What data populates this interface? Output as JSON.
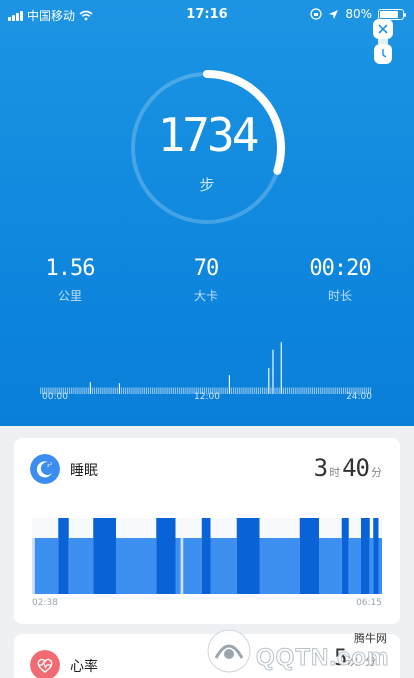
{
  "status_bar": {
    "carrier": "中国移动",
    "time": "17:16",
    "battery": "80%"
  },
  "summary": {
    "steps": "1734",
    "steps_unit": "步",
    "goal_fraction": 0.3
  },
  "stats": [
    {
      "value": "1.56",
      "label": "公里"
    },
    {
      "value": "70",
      "label": "大卡"
    },
    {
      "value": "00:20",
      "label": "时长"
    }
  ],
  "activity_chart": {
    "x_labels": [
      "00:00",
      "12:00",
      "24:00"
    ],
    "bars": [
      0.12,
      0.12,
      0.12,
      0.12,
      0.12,
      0.12,
      0.12,
      0.12,
      0.12,
      0.12,
      0.12,
      0.12,
      0.12,
      0.12,
      0.12,
      0.12,
      0.12,
      0.12,
      0.12,
      0.12,
      0.12,
      0.12,
      0.12,
      0.12,
      0.22,
      0.12,
      0.12,
      0.12,
      0.12,
      0.12,
      0.12,
      0.12,
      0.12,
      0.12,
      0.12,
      0.12,
      0.12,
      0.12,
      0.2,
      0.12,
      0.12,
      0.12,
      0.12,
      0.12,
      0.12,
      0.12,
      0.12,
      0.12,
      0.12,
      0.12,
      0.12,
      0.12,
      0.12,
      0.12,
      0.12,
      0.12,
      0.12,
      0.12,
      0.12,
      0.12,
      0.12,
      0.12,
      0.12,
      0.12,
      0.12,
      0.12,
      0.12,
      0.12,
      0.12,
      0.12,
      0.12,
      0.12,
      0.12,
      0.12,
      0.12,
      0.12,
      0.12,
      0.12,
      0.12,
      0.12,
      0.12,
      0.12,
      0.12,
      0.12,
      0.12,
      0.12,
      0.12,
      0.12,
      0.12,
      0.12,
      0.12,
      0.35,
      0.12,
      0.12,
      0.12,
      0.12,
      0.12,
      0.12,
      0.12,
      0.12,
      0.12,
      0.12,
      0.12,
      0.12,
      0.12,
      0.12,
      0.12,
      0.12,
      0.12,
      0.12,
      0.48,
      0.12,
      0.82,
      0.12,
      0.12,
      0.12,
      0.96,
      0.12,
      0.12,
      0.12,
      0.12,
      0.12,
      0.12,
      0.12,
      0.12,
      0.12,
      0.12,
      0.12,
      0.12,
      0.12,
      0.12,
      0.12,
      0.12,
      0.12,
      0.12,
      0.12,
      0.12,
      0.12,
      0.12,
      0.12,
      0.12,
      0.12,
      0.12,
      0.12,
      0.12,
      0.12,
      0.12,
      0.12,
      0.12,
      0.12,
      0.12,
      0.12,
      0.12,
      0.12,
      0.12,
      0.12,
      0.12,
      0.12,
      0.12,
      0.12
    ]
  },
  "sleep_card": {
    "title": "睡眠",
    "hours": "3",
    "hours_unit": "时",
    "minutes": "40",
    "minutes_unit": "分",
    "start_time": "02:38",
    "end_time": "06:15",
    "segments": [
      [
        "awake",
        0.0,
        0.008
      ],
      [
        "light",
        0.008,
        0.03
      ],
      [
        "light",
        0.03,
        0.075
      ],
      [
        "deep",
        0.075,
        0.105
      ],
      [
        "light",
        0.105,
        0.175
      ],
      [
        "deep",
        0.175,
        0.24
      ],
      [
        "light",
        0.24,
        0.355
      ],
      [
        "deep",
        0.355,
        0.41
      ],
      [
        "light",
        0.41,
        0.425
      ],
      [
        "awake",
        0.425,
        0.432
      ],
      [
        "light",
        0.432,
        0.485
      ],
      [
        "deep",
        0.485,
        0.51
      ],
      [
        "light",
        0.51,
        0.585
      ],
      [
        "deep",
        0.585,
        0.65
      ],
      [
        "light",
        0.65,
        0.765
      ],
      [
        "deep",
        0.765,
        0.82
      ],
      [
        "light",
        0.82,
        0.885
      ],
      [
        "deep",
        0.885,
        0.905
      ],
      [
        "light",
        0.905,
        0.94
      ],
      [
        "deep",
        0.94,
        0.965
      ],
      [
        "light",
        0.965,
        0.975
      ],
      [
        "deep",
        0.975,
        0.99
      ],
      [
        "light",
        0.99,
        1.0
      ]
    ]
  },
  "heart_card": {
    "title": "心率",
    "partial_value": "5",
    "partial_unit": "次/分"
  },
  "watermark": {
    "site_cn": "腾牛网",
    "site_en": "QQTN.com"
  },
  "colors": {
    "hero": "#1d95e3",
    "deep_sleep": "#0a63d6",
    "light_sleep": "#3d8ff0",
    "awake": "#cfe2f8",
    "heart": "#f06b74"
  }
}
